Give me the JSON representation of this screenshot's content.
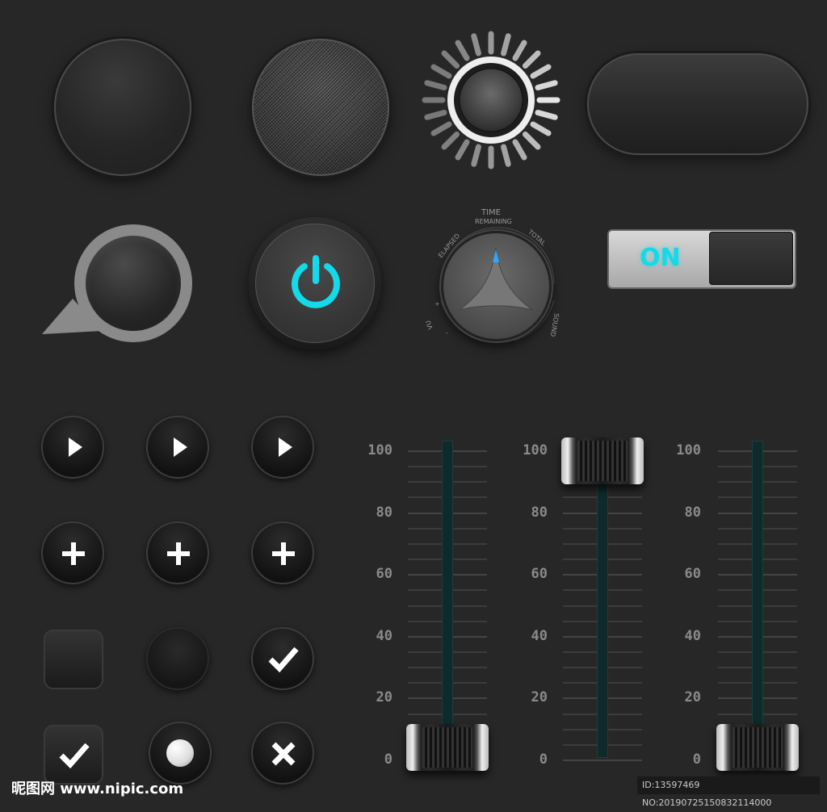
{
  "toggle": {
    "label": "ON",
    "state": "on",
    "accent": "#14d9e8"
  },
  "power_button": {
    "icon": "power-icon",
    "accent": "#14d9e8"
  },
  "knob": {
    "title": "TIME",
    "labels": [
      "REMAINING",
      "ELAPSED",
      "TOTAL",
      "VU",
      "SOUND"
    ],
    "minus": "-",
    "plus": "+"
  },
  "small_buttons": [
    {
      "icon": "play-icon"
    },
    {
      "icon": "play-icon"
    },
    {
      "icon": "play-icon"
    },
    {
      "icon": "plus-icon"
    },
    {
      "icon": "plus-icon"
    },
    {
      "icon": "plus-icon"
    },
    {
      "icon": "square-blank-icon"
    },
    {
      "icon": "circle-blank-icon"
    },
    {
      "icon": "check-icon"
    },
    {
      "icon": "check-icon"
    },
    {
      "icon": "radio-dot-icon"
    },
    {
      "icon": "close-icon"
    }
  ],
  "sliders": [
    {
      "name": "slider-1",
      "value": 0
    },
    {
      "name": "slider-2",
      "value": 100
    },
    {
      "name": "slider-3",
      "value": 0
    }
  ],
  "scale_labels": [
    "100",
    "80",
    "60",
    "40",
    "20",
    "0"
  ],
  "watermark": "昵图网 www.nipic.com",
  "image_id": "ID:13597469 NO:20190725150832114000"
}
